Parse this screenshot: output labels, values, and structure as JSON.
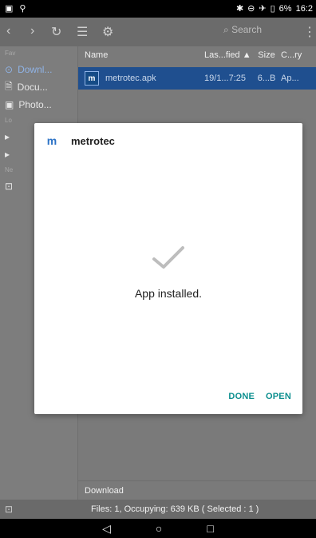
{
  "status_bar": {
    "battery_text": "6%",
    "time": "16:2"
  },
  "toolbar": {
    "search_placeholder": "Search"
  },
  "sidebar": {
    "favorites_label": "Fav",
    "local_label": "Lo",
    "network_label": "Ne",
    "items": [
      {
        "label": "Downl..."
      },
      {
        "label": "Docu..."
      },
      {
        "label": "Photo..."
      }
    ]
  },
  "file_list": {
    "headers": {
      "name": "Name",
      "last_modified": "Las...fied ▲",
      "size": "Size",
      "category": "C...ry"
    },
    "rows": [
      {
        "name": "metrotec.apk",
        "last_modified": "19/1...7:25",
        "size": "6...B",
        "category": "Ap..."
      }
    ]
  },
  "footer": {
    "directory": "Download",
    "files_summary": "Files: 1, Occupying: 639 KB ( Selected : 1 )"
  },
  "dialog": {
    "app_name": "metrotec",
    "message": "App installed.",
    "done_label": "DONE",
    "open_label": "OPEN"
  }
}
